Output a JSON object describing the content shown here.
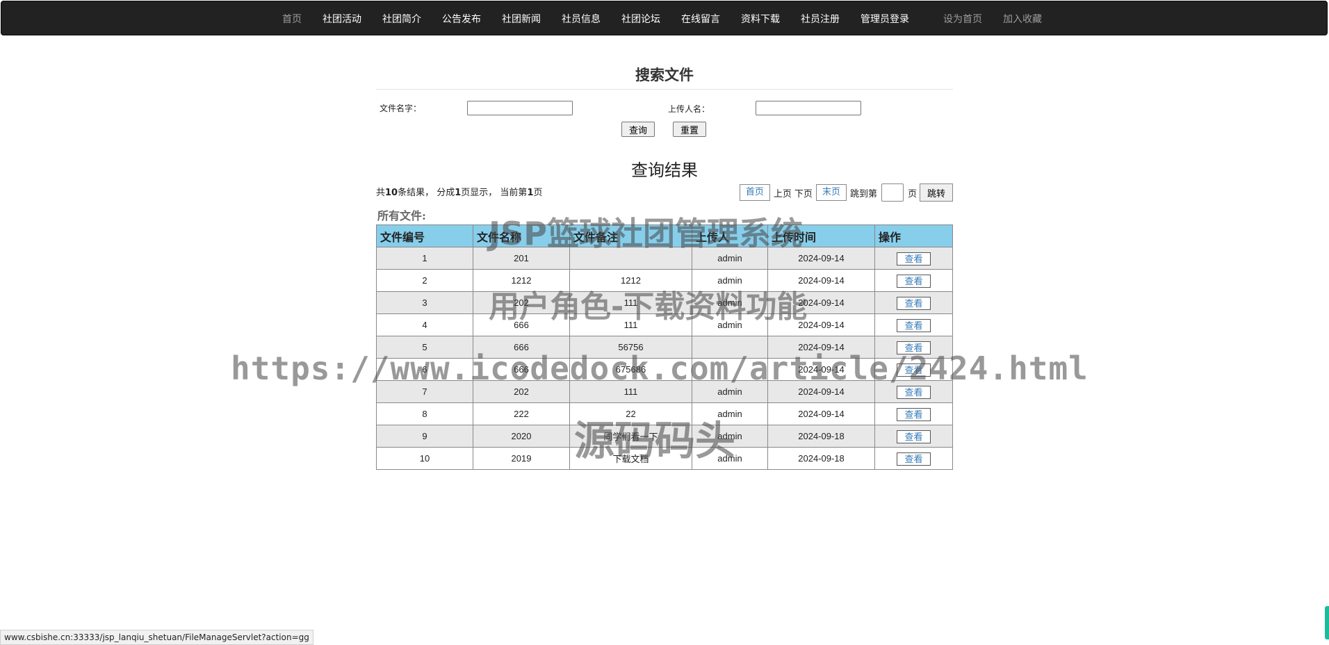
{
  "nav": {
    "items": [
      "首页",
      "社团活动",
      "社团简介",
      "公告发布",
      "社团新闻",
      "社员信息",
      "社团论坛",
      "在线留言",
      "资料下载",
      "社员注册",
      "管理员登录"
    ],
    "extras": [
      "设为首页",
      "加入收藏"
    ]
  },
  "search": {
    "title": "搜索文件",
    "file_name_label": "文件名字：",
    "uploader_label": "上传人名：",
    "file_name_value": "",
    "uploader_value": "",
    "query_button": "查询",
    "reset_button": "重置"
  },
  "results": {
    "title": "查询结果",
    "info_prefix": "共",
    "total": "10",
    "info_mid1": "条结果，  分成",
    "pages": "1",
    "info_mid2": "页显示，  当前第",
    "current": "1",
    "info_suffix": "页"
  },
  "pager": {
    "first": "首页",
    "prev": "上页",
    "next": "下页",
    "last": "末页",
    "jump_label": "跳到第",
    "page_unit": "页",
    "jump_button": "跳转",
    "jump_value": ""
  },
  "files": {
    "label": "所有文件:",
    "columns": [
      "文件编号",
      "文件名称",
      "文件备注",
      "上传人",
      "上传时间",
      "操作"
    ],
    "rows": [
      {
        "id": "1",
        "name": "201",
        "note": "",
        "uploader": "admin",
        "time": "2024-09-14",
        "action": "查看"
      },
      {
        "id": "2",
        "name": "1212",
        "note": "1212",
        "uploader": "admin",
        "time": "2024-09-14",
        "action": "查看"
      },
      {
        "id": "3",
        "name": "202",
        "note": "111",
        "uploader": "admin",
        "time": "2024-09-14",
        "action": "查看"
      },
      {
        "id": "4",
        "name": "666",
        "note": "111",
        "uploader": "admin",
        "time": "2024-09-14",
        "action": "查看"
      },
      {
        "id": "5",
        "name": "666",
        "note": "56756",
        "uploader": "",
        "time": "2024-09-14",
        "action": "查看"
      },
      {
        "id": "6",
        "name": "666",
        "note": "675686",
        "uploader": "",
        "time": "2024-09-14",
        "action": "查看"
      },
      {
        "id": "7",
        "name": "202",
        "note": "111",
        "uploader": "admin",
        "time": "2024-09-14",
        "action": "查看"
      },
      {
        "id": "8",
        "name": "222",
        "note": "22",
        "uploader": "admin",
        "time": "2024-09-14",
        "action": "查看"
      },
      {
        "id": "9",
        "name": "2020",
        "note": "同学们看一下",
        "uploader": "admin",
        "time": "2024-09-18",
        "action": "查看"
      },
      {
        "id": "10",
        "name": "2019",
        "note": "下载文档",
        "uploader": "admin",
        "time": "2024-09-18",
        "action": "查看"
      }
    ]
  },
  "watermarks": {
    "title": "JSP篮球社团管理系统",
    "subtitle": "用户角色-下载资料功能",
    "url": "https://www.icodedock.com/article/2424.html",
    "brand": "源码码头"
  },
  "status_bar": {
    "url": "www.csbishe.cn:33333/jsp_lanqiu_shetuan/FileManageServlet?action=gg"
  },
  "colors": {
    "navbar_bg": "#222222",
    "table_header_bg": "#87ceeb",
    "link_blue": "#337ab7"
  }
}
